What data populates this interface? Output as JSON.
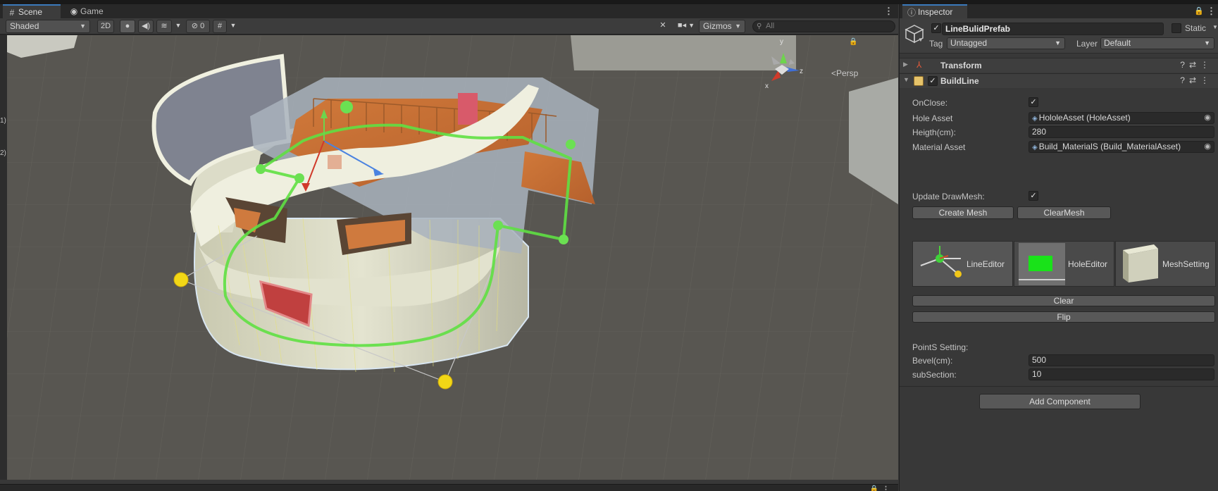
{
  "scene": {
    "tabs": [
      {
        "label": "Scene",
        "icon": "grid-icon"
      },
      {
        "label": "Game",
        "icon": "gamepad-icon"
      }
    ],
    "toolbar": {
      "shading": "Shaded",
      "mode_2d": "2D",
      "hidden_count": "0",
      "gizmos": "Gizmos",
      "search_placeholder": "All"
    },
    "view_label": "<Persp",
    "axis": {
      "x": "x",
      "y": "y",
      "z": "z"
    },
    "gutter_marks": [
      "1)",
      "2)"
    ]
  },
  "inspector": {
    "tab_label": "Inspector",
    "object": {
      "name": "LineBulidPrefab",
      "static_label": "Static",
      "tag_label": "Tag",
      "tag_value": "Untagged",
      "layer_label": "Layer",
      "layer_value": "Default"
    },
    "components": {
      "transform": "Transform",
      "buildline": "BuildLine"
    },
    "fields": {
      "onclose_label": "OnClose:",
      "hole_asset_label": "Hole Asset",
      "hole_asset_value": "HololeAsset (HoleAsset)",
      "height_label": "Heigth(cm):",
      "height_value": "280",
      "material_asset_label": "Material Asset",
      "material_asset_value": "Build_MaterialS (Build_MaterialAsset)",
      "update_drawmesh_label": "Update DrawMesh:",
      "create_mesh": "Create Mesh",
      "clear_mesh": "ClearMesh"
    },
    "tools": [
      "LineEditor",
      "HoleEditor",
      "MeshSetting"
    ],
    "actions": {
      "clear": "Clear",
      "flip": "Flip"
    },
    "points": {
      "header": "PointS Setting:",
      "bevel_label": "Bevel(cm):",
      "bevel_value": "500",
      "subsection_label": "subSection:",
      "subsection_value": "10"
    },
    "add_component": "Add Component"
  },
  "colors": {
    "accent": "#3a79bb",
    "spline": "#63e04a",
    "handle": "#f2d716",
    "ground": "#585651"
  }
}
